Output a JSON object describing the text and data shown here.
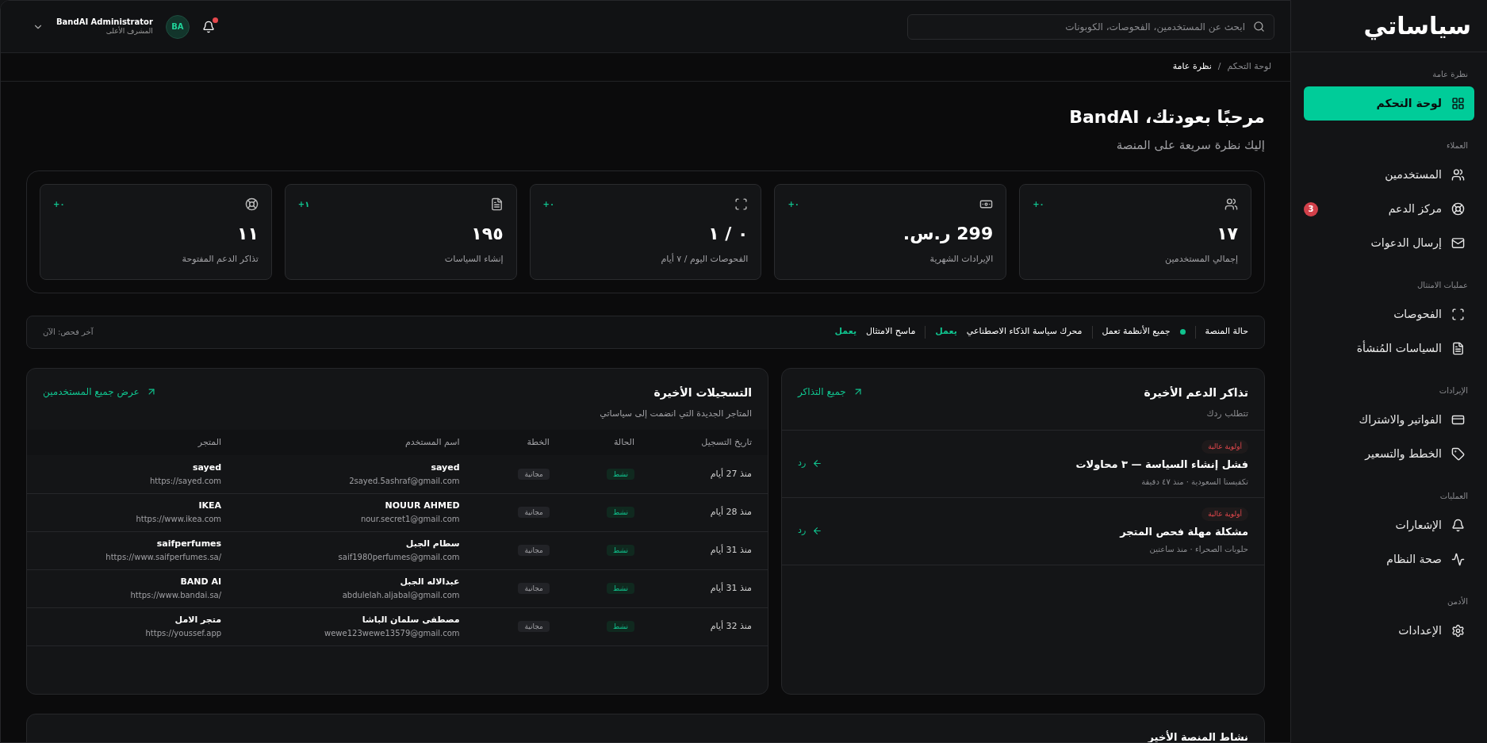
{
  "sidebar": {
    "logo": "سياساتي",
    "sections": [
      {
        "title": "نظرة عامة",
        "items": [
          {
            "label": "لوحة التحكم",
            "selected": true
          }
        ]
      },
      {
        "title": "العملاء",
        "items": [
          {
            "label": "المستخدمين",
            "selected": false
          },
          {
            "label": "مركز الدعم",
            "selected": false,
            "badge": "3"
          },
          {
            "label": "إرسال الدعوات",
            "selected": false
          }
        ]
      },
      {
        "title": "عمليات الامتثال",
        "items": [
          {
            "label": "الفحوصات",
            "selected": false
          },
          {
            "label": "السياسات المُنشأة",
            "selected": false
          }
        ]
      },
      {
        "title": "الإيرادات",
        "items": [
          {
            "label": "الفواتير والاشتراك",
            "selected": false
          },
          {
            "label": "الخطط والتسعير",
            "selected": false
          }
        ]
      },
      {
        "title": "العمليات",
        "items": [
          {
            "label": "الإشعارات",
            "selected": false
          },
          {
            "label": "صحة النظام",
            "selected": false
          }
        ]
      },
      {
        "title": "الأدمن",
        "items": [
          {
            "label": "الإعدادات",
            "selected": false
          }
        ]
      }
    ]
  },
  "header": {
    "search": {
      "placeholder": "ابحث عن المستخدمين، الفحوصات، الكوبونات"
    },
    "notifications_unread": true,
    "user": {
      "initials": "BA",
      "name": "BandAI Administrator",
      "role": "المشرف الأعلى"
    }
  },
  "breadcrumb": [
    "لوحة التحكم",
    "/",
    "نظرة عامة"
  ],
  "welcome": {
    "title": "مرحبًا بعودتك، BandAI",
    "subtitle": "إليك نظرة سريعة على المنصة"
  },
  "stats": [
    {
      "value": "١٧",
      "label": "إجمالي المستخدمين",
      "delta": "+٠"
    },
    {
      "value": "299 ر.س.",
      "label": "الإيرادات الشهرية",
      "delta": "+٠"
    },
    {
      "value": "٠ / ١",
      "label": "الفحوصات اليوم / ٧ أيام",
      "delta": "+٠"
    },
    {
      "value": "١٩٥",
      "label": "إنشاء السياسات",
      "delta": "+١"
    },
    {
      "value": "١١",
      "label": "تذاكر الدعم المفتوحة",
      "delta": "+٠"
    }
  ],
  "status_bar": {
    "title": "حالة المنصة",
    "overall": {
      "label": "جميع الأنظمة تعمل",
      "color": "#10c38e"
    },
    "services": [
      {
        "name": "محرك سياسة الذكاء الاصطناعي",
        "status": "يعمل"
      },
      {
        "name": "ماسح الامتثال",
        "status": "يعمل"
      }
    ],
    "last_check": "آخر فحص: الآن"
  },
  "tickets": {
    "title": "تذاكر الدعم الأخيرة",
    "subtitle": "تتطلب ردك",
    "link": "جميع التذاكر",
    "items": [
      {
        "priority": "أولوية عالية",
        "title": "فشل إنشاء السياسة — ٣ محاولات",
        "meta": "تكفيستا السعودية · منذ ٤٧ دقيقة",
        "action": "رد"
      },
      {
        "priority": "أولوية عالية",
        "title": "مشكلة مهلة فحص المتجر",
        "meta": "حلويات الصحراء · منذ ساعتين",
        "action": "رد"
      }
    ]
  },
  "signups": {
    "title": "التسجيلات الأخيرة",
    "subtitle": "المتاجر الجديدة التي انضمت إلى سياساتي",
    "link": "عرض جميع المستخدمين",
    "columns": [
      "تاريخ التسجيل",
      "الحالة",
      "الخطة",
      "اسم المستخدم",
      "المتجر"
    ],
    "rows": [
      {
        "date": "منذ 27 أيام",
        "status": "نشط",
        "plan": "مجانية",
        "user": "sayed",
        "email": "2sayed.5ashraf@gmail.com",
        "store": "sayed",
        "url": "https://sayed.com"
      },
      {
        "date": "منذ 28 أيام",
        "status": "نشط",
        "plan": "مجانية",
        "user": "NOUUR AHMED",
        "email": "nour.secret1@gmail.com",
        "store": "IKEA",
        "url": "https://www.ikea.com"
      },
      {
        "date": "منذ 31 أيام",
        "status": "نشط",
        "plan": "مجانية",
        "user": "سطام الجبل",
        "email": "saif1980perfumes@gmail.com",
        "store": "saifperfumes",
        "url": "https://www.saifperfumes.sa/"
      },
      {
        "date": "منذ 31 أيام",
        "status": "نشط",
        "plan": "مجانية",
        "user": "عبدالاله الجبل",
        "email": "abdulelah.aljabal@gmail.com",
        "store": "BAND AI",
        "url": "https://www.bandai.sa/"
      },
      {
        "date": "منذ 32 أيام",
        "status": "نشط",
        "plan": "مجانية",
        "user": "مصطفى سلمان الباشا",
        "email": "wewe123wewe13579@gmail.com",
        "store": "متجر الامل",
        "url": "https://youssef.app"
      }
    ]
  },
  "activity": {
    "title": "نشاط المنصة الأخير"
  }
}
